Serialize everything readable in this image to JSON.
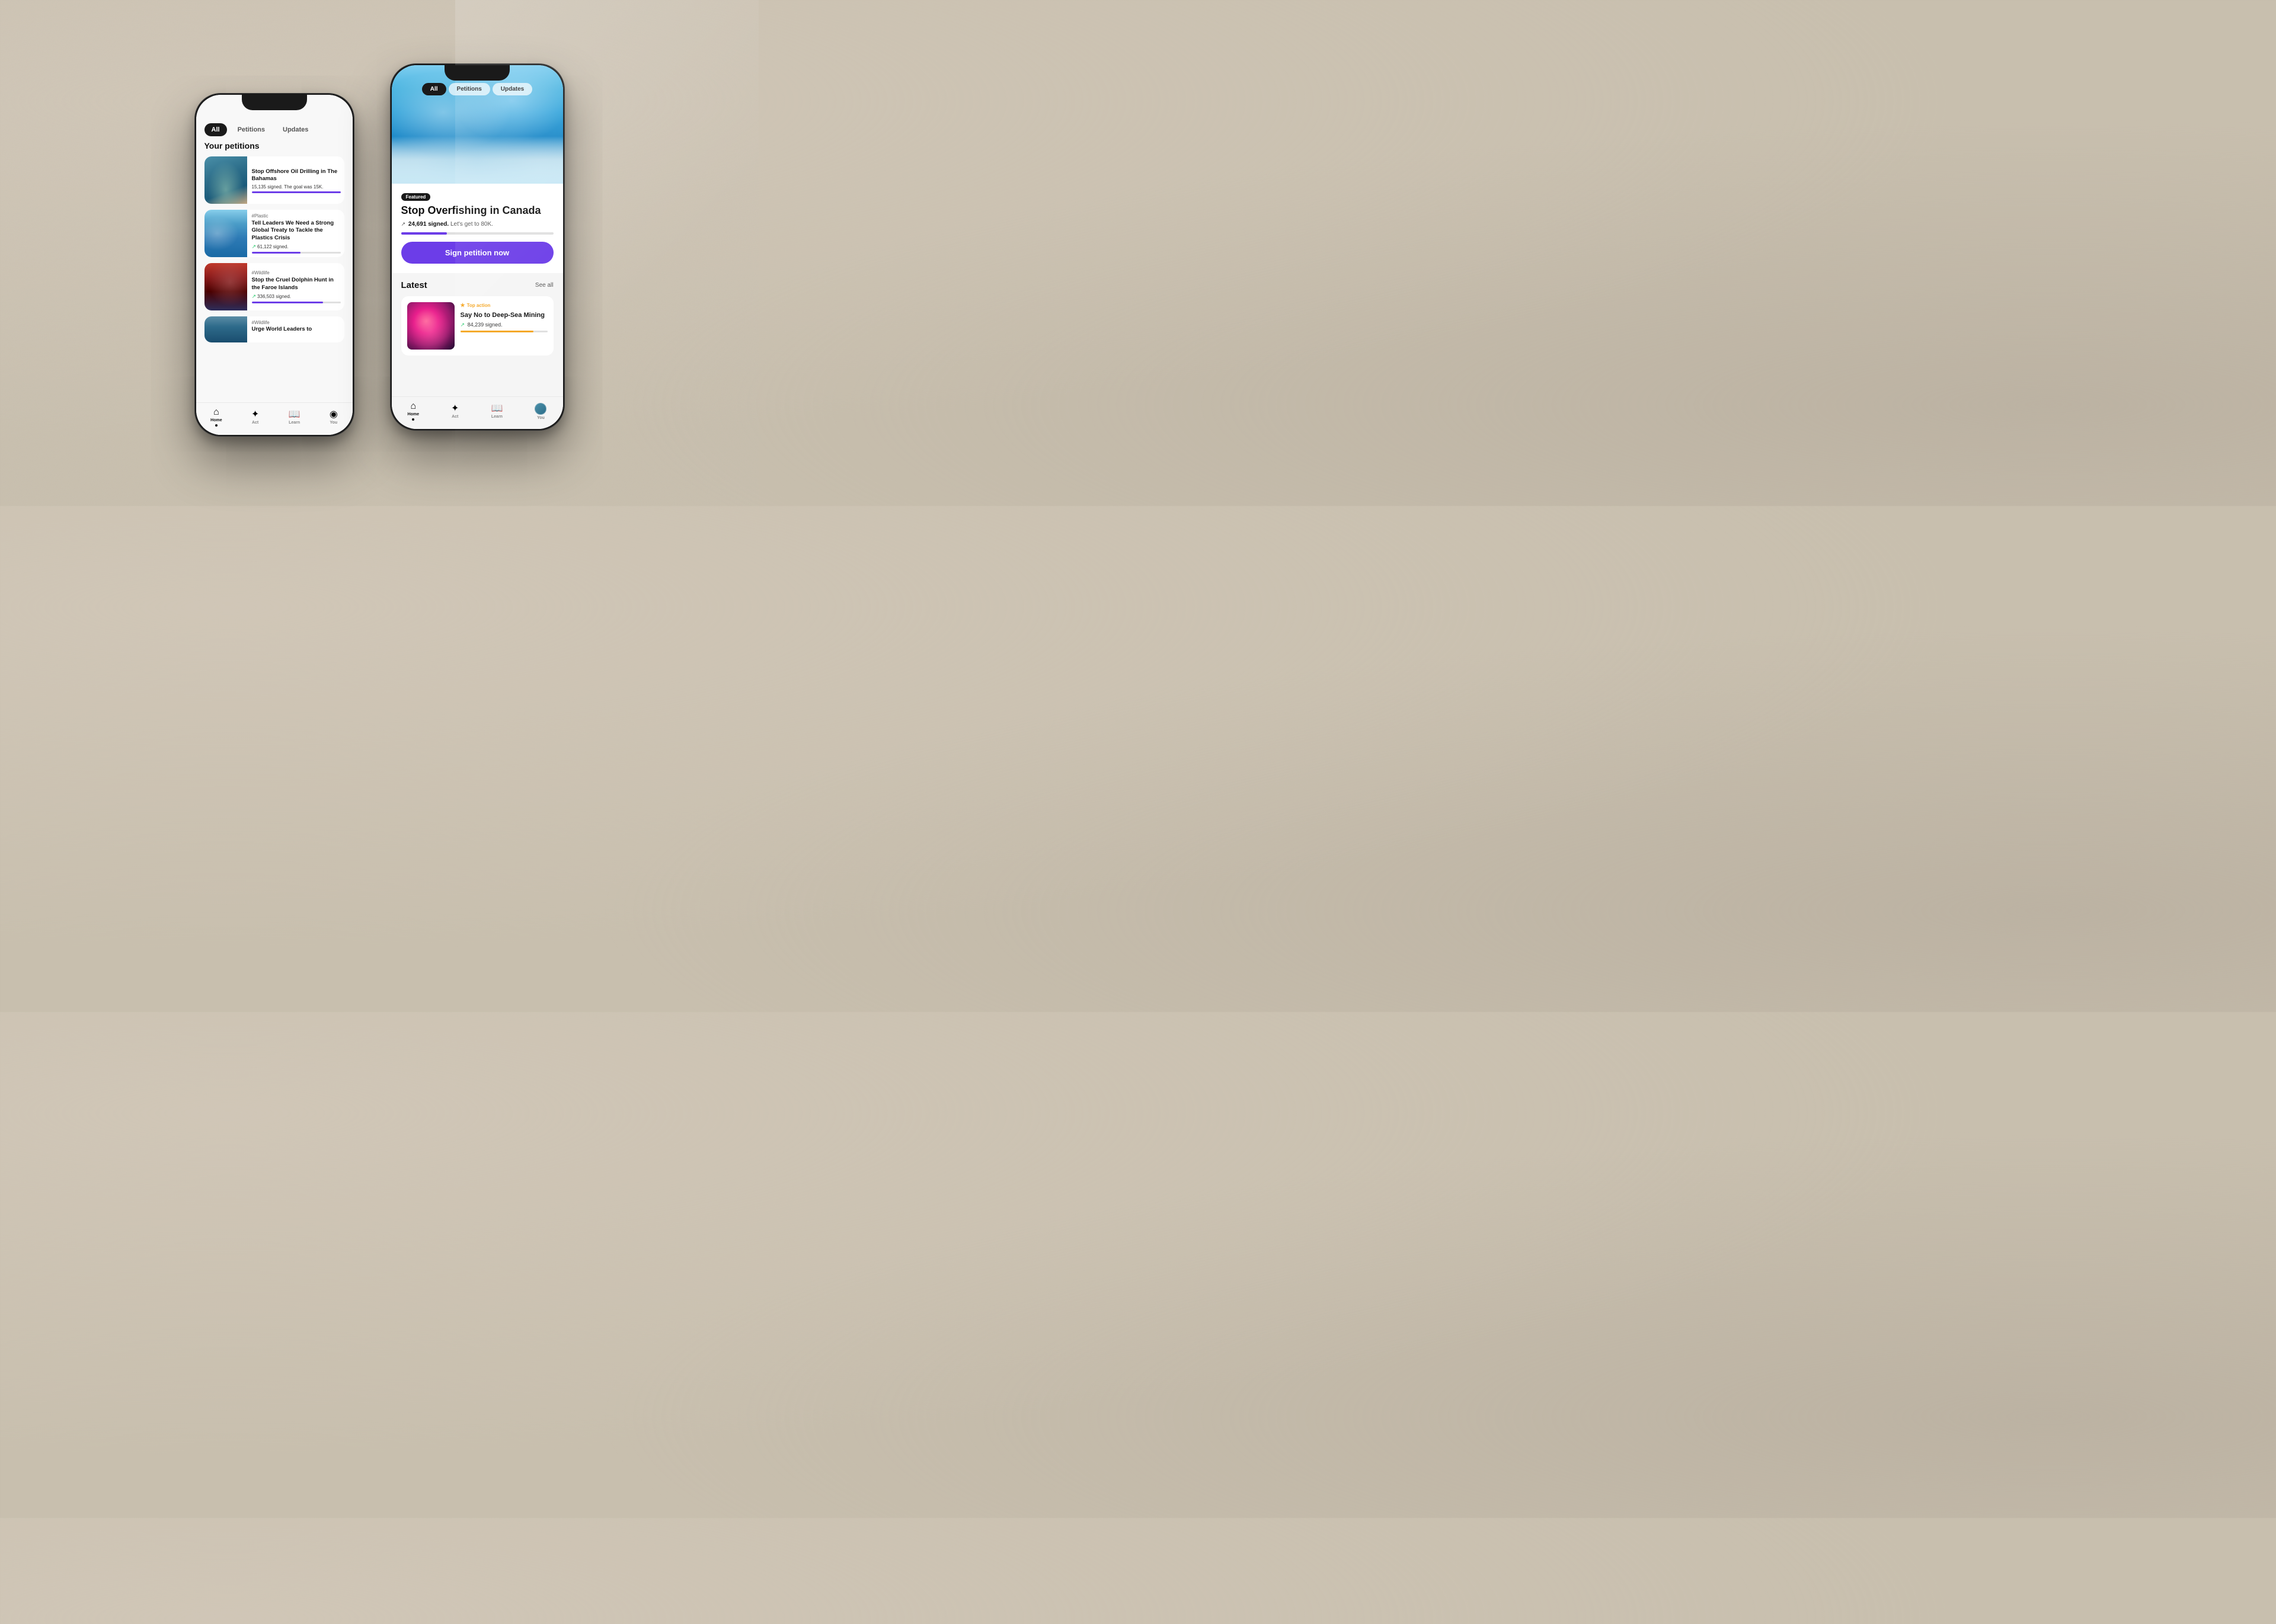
{
  "background": {
    "color": "#c8bfae"
  },
  "phoneLeft": {
    "tabs": [
      {
        "label": "All",
        "active": true
      },
      {
        "label": "Petitions",
        "active": false
      },
      {
        "label": "Updates",
        "active": false
      }
    ],
    "sectionTitle": "Your petitions",
    "petitions": [
      {
        "tag": "",
        "title": "Stop Offshore Oil Drilling in The Bahamas",
        "stats": "15,135 signed. The goal was 15K.",
        "progress": "complete",
        "thumbClass": "thumb-offshore"
      },
      {
        "tag": "#Plastic",
        "title": "Tell Leaders We Need a Strong Global Treaty to Tackle the Plastics Crisis",
        "stats": "61,122 signed.",
        "progress": "partial",
        "thumbClass": "thumb-plastic"
      },
      {
        "tag": "#Wildlife",
        "title": "Stop the Cruel Dolphin Hunt in the Faroe Islands",
        "stats": "336,503 signed.",
        "progress": "high",
        "thumbClass": "thumb-dolphin"
      }
    ],
    "partialCard": {
      "tag": "#Wildlife",
      "title": "Urge World Leaders to"
    },
    "bottomNav": [
      {
        "label": "Home",
        "icon": "⌂",
        "active": true
      },
      {
        "label": "Act",
        "icon": "✦",
        "active": false
      },
      {
        "label": "Learn",
        "icon": "📖",
        "active": false
      },
      {
        "label": "You",
        "icon": "◉",
        "active": false
      }
    ]
  },
  "phoneRight": {
    "tabs": [
      {
        "label": "All",
        "active": true
      },
      {
        "label": "Petitions",
        "active": false
      },
      {
        "label": "Updates",
        "active": false
      }
    ],
    "featured": {
      "badge": "Featured",
      "title": "Stop Overfishing in Canada",
      "statsStrong": "24,691 signed.",
      "statsLight": " Let's get to 80K.",
      "signButton": "Sign petition now"
    },
    "latest": {
      "title": "Latest",
      "seeAll": "See all",
      "cards": [
        {
          "topActionLabel": "Top action",
          "title": "Say No to Deep-Sea Mining",
          "stats": "84,239 signed.",
          "thumbClass": "latest-thumb"
        }
      ]
    },
    "bottomNav": [
      {
        "label": "Home",
        "icon": "⌂",
        "active": true
      },
      {
        "label": "Act",
        "icon": "✦",
        "active": false
      },
      {
        "label": "Learn",
        "icon": "📖",
        "active": false
      },
      {
        "label": "You",
        "icon": "globe",
        "active": false
      }
    ]
  }
}
